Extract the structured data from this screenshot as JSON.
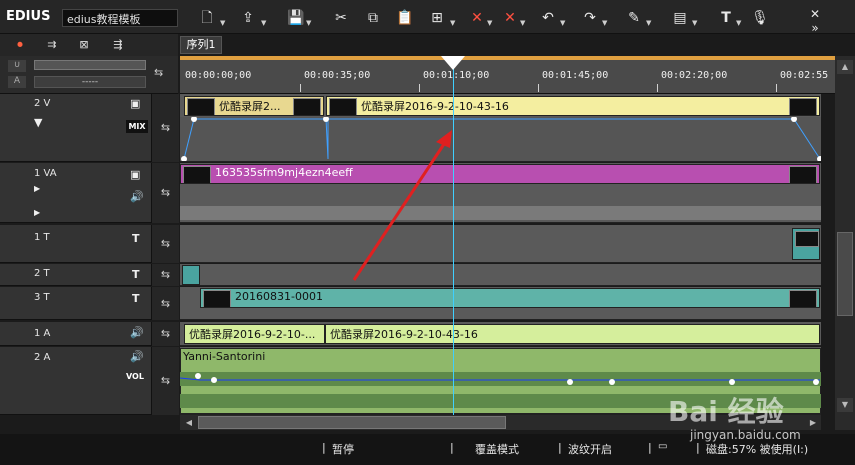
{
  "app": {
    "title": "EDIUS",
    "project_name": "edius教程模板"
  },
  "sequence": {
    "tab_label": "序列1"
  },
  "ruler": {
    "timecodes": [
      "00:00:00;00",
      "00:00:35;00",
      "00:01:10;00",
      "00:01:45;00",
      "00:02:20;00",
      "00:02:55"
    ],
    "ctrl_label": "-----"
  },
  "tracks": {
    "v2": {
      "name": "2 V",
      "mix_label": "MIX",
      "clip_a": "优酷录屏2...",
      "clip_b": "优酷录屏2016-9-2-10-43-16"
    },
    "va1": {
      "name": "1 VA",
      "clip": "163535sfm9mj4ezn4eeff"
    },
    "t1": {
      "name": "1 T"
    },
    "t2": {
      "name": "2 T"
    },
    "t3": {
      "name": "3 T",
      "clip": "20160831-0001"
    },
    "a1": {
      "name": "1 A",
      "clip_a": "优酷录屏2016-9-2-10-...",
      "clip_b": "优酷录屏2016-9-2-10-43-16"
    },
    "a2": {
      "name": "2 A",
      "vol_label": "VOL",
      "clip": "Yanni-Santorini"
    }
  },
  "status": {
    "pause": "暂停",
    "overwrite": "覆盖模式",
    "ripple": "波纹开启",
    "disk": "磁盘:57% 被使用(I:)"
  },
  "watermark": {
    "text": "Bai 经验",
    "url": "jingyan.baidu.com"
  },
  "colors": {
    "v2_clip": "#f4eea0",
    "va1_clip": "#b84fb0",
    "t3_clip": "#5fb3a8",
    "a1_clip": "#d5ee9c",
    "a2_clip": "#8fb86a",
    "cursor": "#3fd0ff",
    "arrow": "#e02020"
  }
}
